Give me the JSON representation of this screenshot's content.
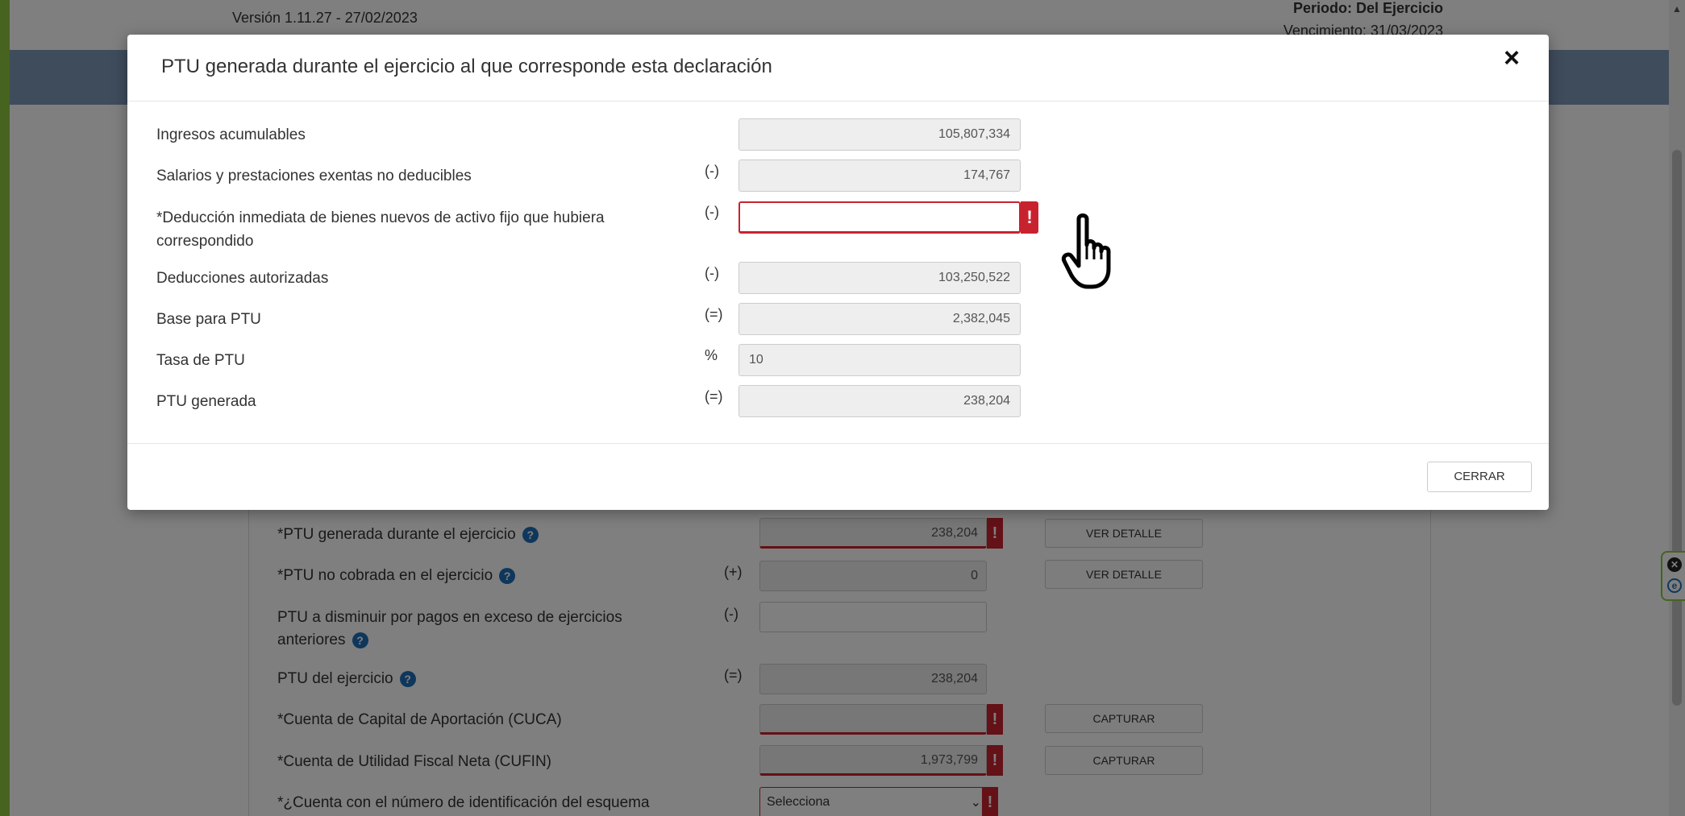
{
  "page": {
    "version": "Versión 1.11.27 - 27/02/2023",
    "periodo": "Periodo: Del Ejercicio",
    "vencimiento": "Vencimiento: 31/03/2023"
  },
  "background_rows": [
    {
      "label": "*PTU generada durante el ejercicio",
      "operator": "",
      "value": "238,204",
      "button": "VER DETALLE"
    },
    {
      "label": "*PTU no cobrada en el ejercicio",
      "operator": "(+)",
      "value": "0",
      "button": "VER DETALLE"
    },
    {
      "label_line1": "PTU a disminuir por pagos en exceso de ejercicios",
      "label_line2": "anteriores",
      "operator": "(-)",
      "value": ""
    },
    {
      "label": "PTU del ejercicio",
      "operator": "(=)",
      "value": "238,204"
    },
    {
      "label": "*Cuenta de Capital de Aportación (CUCA)",
      "operator": "",
      "value": "",
      "button": "CAPTURAR"
    },
    {
      "label": "*Cuenta de Utilidad Fiscal Neta (CUFIN)",
      "operator": "",
      "value": "1,973,799",
      "button": "CAPTURAR"
    },
    {
      "label": "*¿Cuenta con el número de identificación del esquema",
      "select": "Selecciona"
    }
  ],
  "modal": {
    "title": "PTU generada durante el ejercicio al que corresponde esta declaración",
    "close_symbol": "×",
    "rows": [
      {
        "label": "Ingresos acumulables",
        "operator": "",
        "value": "105,807,334"
      },
      {
        "label": "Salarios y prestaciones exentas no deducibles",
        "operator": "(-)",
        "value": "174,767"
      },
      {
        "label_line1": "*Deducción inmediata de bienes nuevos de activo fijo que hubiera",
        "label_line2": "correspondido",
        "operator": "(-)",
        "value": ""
      },
      {
        "label": "Deducciones autorizadas",
        "operator": "(-)",
        "value": "103,250,522"
      },
      {
        "label": "Base para PTU",
        "operator": "(=)",
        "value": "2,382,045"
      },
      {
        "label": "Tasa de PTU",
        "operator": "%",
        "value": "10"
      },
      {
        "label": "PTU generada",
        "operator": "(=)",
        "value": "238,204"
      }
    ],
    "error_symbol": "!",
    "close_button": "CERRAR"
  },
  "icons": {
    "help": "?",
    "chevron": "⌄",
    "widget_close": "✕",
    "widget_e": "e"
  },
  "colors": {
    "error": "#c9222f",
    "help_blue": "#1e6fb8",
    "band": "#7e98b8",
    "accent_green": "#8dc63f"
  }
}
